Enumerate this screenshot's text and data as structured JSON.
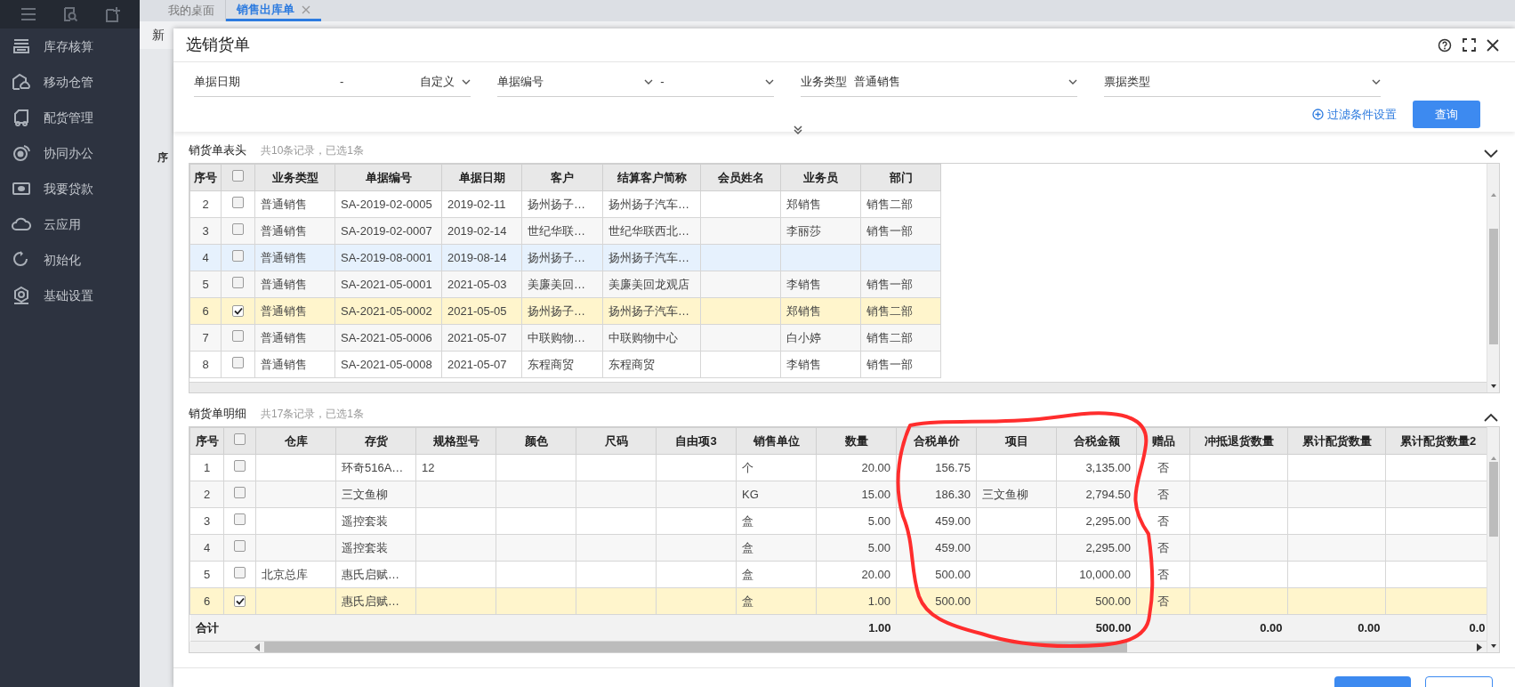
{
  "sidebar": {
    "items": [
      {
        "label": "库存核算"
      },
      {
        "label": "移动仓管"
      },
      {
        "label": "配货管理"
      },
      {
        "label": "协同办公"
      },
      {
        "label": "我要贷款"
      },
      {
        "label": "云应用"
      },
      {
        "label": "初始化"
      },
      {
        "label": "基础设置"
      }
    ]
  },
  "tabs": [
    {
      "label": "我的桌面",
      "selected": false,
      "closable": false
    },
    {
      "label": "销售出库单",
      "selected": true,
      "closable": true
    }
  ],
  "background": {
    "toolbar_text": "新",
    "table_header_text": "序"
  },
  "dialog": {
    "title": "选销货单",
    "filters": [
      {
        "kind": "date",
        "label": "单据日期",
        "value": "-",
        "mode": "自定义"
      },
      {
        "kind": "range",
        "label": "单据编号",
        "value": "-"
      },
      {
        "kind": "select",
        "label": "业务类型",
        "value": "普通销售"
      },
      {
        "kind": "select",
        "label": "票据类型"
      }
    ],
    "filter_settings_link": "过滤条件设置",
    "query_button": "查询",
    "header_section": {
      "title": "销货单表头",
      "summary": "共10条记录，已选1条",
      "all_checked": false,
      "columns": [
        "序号",
        "业务类型",
        "单据编号",
        "单据日期",
        "客户",
        "结算客户简称",
        "会员姓名",
        "业务员",
        "部门"
      ],
      "rows": [
        {
          "cells": [
            "2",
            "普通销售",
            "SA-2019-02-0005",
            "2019-02-11",
            "扬州扬子…",
            "扬州扬子汽车…",
            null,
            "郑销售",
            "销售二部"
          ],
          "selected": false,
          "hovered": false
        },
        {
          "cells": [
            "3",
            "普通销售",
            "SA-2019-02-0007",
            "2019-02-14",
            "世纪华联…",
            "世纪华联西北…",
            null,
            "李丽莎",
            "销售一部"
          ],
          "selected": false,
          "hovered": false
        },
        {
          "cells": [
            "4",
            "普通销售",
            "SA-2019-08-0001",
            "2019-08-14",
            "扬州扬子…",
            "扬州扬子汽车…",
            null,
            null,
            null
          ],
          "selected": false,
          "hovered": true
        },
        {
          "cells": [
            "5",
            "普通销售",
            "SA-2021-05-0001",
            "2021-05-03",
            "美廉美回…",
            "美廉美回龙观店",
            null,
            "李销售",
            "销售一部"
          ],
          "selected": false,
          "hovered": false
        },
        {
          "cells": [
            "6",
            "普通销售",
            "SA-2021-05-0002",
            "2021-05-05",
            "扬州扬子…",
            "扬州扬子汽车…",
            null,
            "郑销售",
            "销售二部"
          ],
          "selected": true,
          "hovered": false
        },
        {
          "cells": [
            "7",
            "普通销售",
            "SA-2021-05-0006",
            "2021-05-07",
            "中联购物…",
            "中联购物中心",
            null,
            "白小婷",
            "销售二部"
          ],
          "selected": false,
          "hovered": false
        },
        {
          "cells": [
            "8",
            "普通销售",
            "SA-2021-05-0008",
            "2021-05-07",
            "东程商贸",
            "东程商贸",
            null,
            "李销售",
            "销售一部"
          ],
          "selected": false,
          "hovered": false
        }
      ]
    },
    "detail_section": {
      "title": "销货单明细",
      "summary": "共17条记录，已选1条",
      "all_checked": false,
      "columns": [
        "序号",
        "仓库",
        "存货",
        "规格型号",
        "颜色",
        "尺码",
        "自由项3",
        "销售单位",
        "数量",
        "合税单价",
        "项目",
        "合税金额",
        "赠品",
        "冲抵退货数量",
        "累计配货数量",
        "累计配货数量2"
      ],
      "rows": [
        {
          "cells": [
            "1",
            null,
            "环奇516A…",
            "12",
            null,
            null,
            null,
            "个",
            "20.00",
            "156.75",
            null,
            "3,135.00",
            "否",
            null,
            null,
            null
          ],
          "selected": false
        },
        {
          "cells": [
            "2",
            null,
            "三文鱼柳",
            null,
            null,
            null,
            null,
            "KG",
            "15.00",
            "186.30",
            "三文鱼柳",
            "2,794.50",
            "否",
            null,
            null,
            null
          ],
          "selected": false
        },
        {
          "cells": [
            "3",
            null,
            "遥控套装",
            null,
            null,
            null,
            null,
            "盒",
            "5.00",
            "459.00",
            null,
            "2,295.00",
            "否",
            null,
            null,
            null
          ],
          "selected": false
        },
        {
          "cells": [
            "4",
            null,
            "遥控套装",
            null,
            null,
            null,
            null,
            "盒",
            "5.00",
            "459.00",
            null,
            "2,295.00",
            "否",
            null,
            null,
            null
          ],
          "selected": false
        },
        {
          "cells": [
            "5",
            "北京总库",
            "惠氏启赋…",
            null,
            null,
            null,
            null,
            "盒",
            "20.00",
            "500.00",
            null,
            "10,000.00",
            "否",
            null,
            null,
            null
          ],
          "selected": false
        },
        {
          "cells": [
            "6",
            null,
            "惠氏启赋…",
            null,
            null,
            null,
            null,
            "盒",
            "1.00",
            "500.00",
            null,
            "500.00",
            "否",
            null,
            null,
            null
          ],
          "selected": true
        }
      ],
      "totals": [
        {
          "kind": "label",
          "text": "合计"
        },
        {
          "kind": "empty"
        },
        {
          "kind": "empty"
        },
        {
          "kind": "empty"
        },
        {
          "kind": "empty"
        },
        {
          "kind": "empty"
        },
        {
          "kind": "empty"
        },
        {
          "kind": "empty"
        },
        {
          "kind": "value",
          "text": "1.00"
        },
        {
          "kind": "empty"
        },
        {
          "kind": "empty"
        },
        {
          "kind": "value",
          "text": "500.00"
        },
        {
          "kind": "empty"
        },
        {
          "kind": "value",
          "text": "0.00"
        },
        {
          "kind": "value",
          "text": "0.00"
        },
        {
          "kind": "value",
          "text": "0.0"
        }
      ]
    }
  }
}
